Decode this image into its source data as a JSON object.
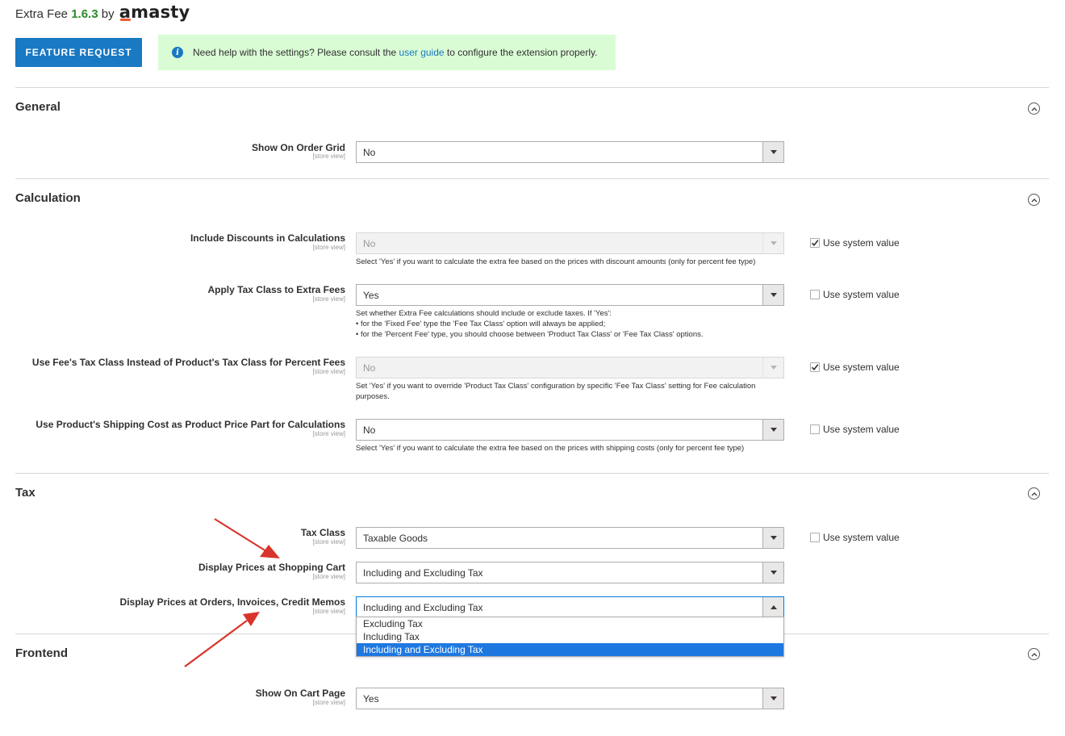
{
  "header": {
    "product_name": "Extra Fee",
    "version": "1.6.3",
    "by": "by",
    "brand": "amasty",
    "feature_request_label": "Feature Request",
    "help_prefix": "Need help with the settings? Please consult the",
    "help_link": "user guide",
    "help_suffix": "to configure the extension properly."
  },
  "sections": {
    "general": {
      "title": "General",
      "show_on_order_grid": {
        "label": "Show On Order Grid",
        "scope": "[store view]",
        "value": "No"
      }
    },
    "calculation": {
      "title": "Calculation",
      "include_discounts": {
        "label": "Include Discounts in Calculations",
        "scope": "[store view]",
        "value": "No",
        "note": "Select 'Yes' if you want to calculate the extra fee based on the prices with discount amounts (only for percent fee type)",
        "use_system_value": true
      },
      "apply_tax_class": {
        "label": "Apply Tax Class to Extra Fees",
        "scope": "[store view]",
        "value": "Yes",
        "note_lines": [
          "Set whether Extra Fee calculations should include or exclude taxes. If 'Yes':",
          "• for the 'Fixed Fee' type the 'Fee Tax Class' option will always be applied;",
          "• for the 'Percent Fee' type, you should choose between 'Product Tax Class' or 'Fee Tax Class' options."
        ],
        "use_system_value": false
      },
      "use_fee_tax_class": {
        "label": "Use Fee's Tax Class Instead of Product's Tax Class for Percent Fees",
        "scope": "[store view]",
        "value": "No",
        "note": "Set 'Yes' if you want to override 'Product Tax Class' configuration by specific 'Fee Tax Class' setting for Fee calculation purposes.",
        "use_system_value": true
      },
      "use_shipping_cost": {
        "label": "Use Product's Shipping Cost as Product Price Part for Calculations",
        "scope": "[store view]",
        "value": "No",
        "note": "Select 'Yes' if you want to calculate the extra fee based on the prices with shipping costs (only for percent fee type)",
        "use_system_value": false
      }
    },
    "tax": {
      "title": "Tax",
      "tax_class": {
        "label": "Tax Class",
        "scope": "[store view]",
        "value": "Taxable Goods",
        "use_system_value": false
      },
      "display_cart": {
        "label": "Display Prices at Shopping Cart",
        "scope": "[store view]",
        "value": "Including and Excluding Tax"
      },
      "display_orders": {
        "label": "Display Prices at Orders, Invoices, Credit Memos",
        "scope": "[store view]",
        "value": "Including and Excluding Tax",
        "options": [
          "Excluding Tax",
          "Including Tax",
          "Including and Excluding Tax"
        ],
        "selected_index": 2
      }
    },
    "frontend": {
      "title": "Frontend",
      "show_on_cart": {
        "label": "Show On Cart Page",
        "scope": "[store view]",
        "value": "Yes"
      }
    }
  },
  "use_system_value_label": "Use system value",
  "colors": {
    "accent": "#1979c3",
    "annotation_arrow": "#d9342b",
    "help_bg": "#dafcd5",
    "version": "#2b8a29"
  }
}
